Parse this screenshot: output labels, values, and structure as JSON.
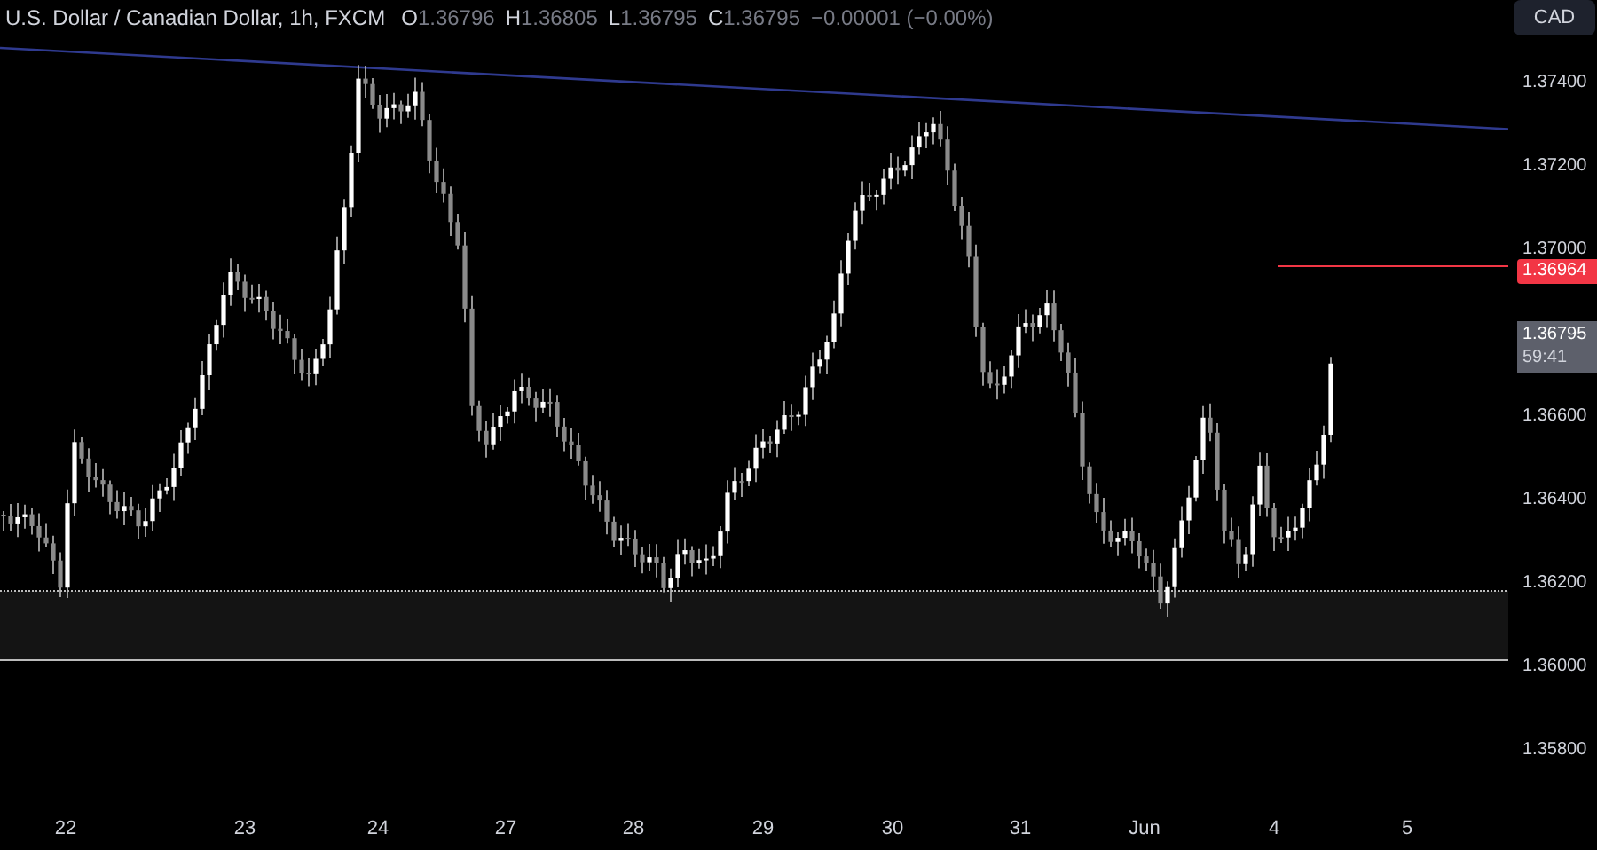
{
  "header": {
    "title": "U.S. Dollar / Canadian Dollar, 1h, FXCM",
    "ohlc": [
      {
        "label": "O",
        "value": "1.36796"
      },
      {
        "label": "H",
        "value": "1.36805"
      },
      {
        "label": "L",
        "value": "1.36795"
      },
      {
        "label": "C",
        "value": "1.36795"
      }
    ],
    "change": "−0.00001 (−0.00%)"
  },
  "currency_button": "CAD",
  "price_axis": [
    "1.37400",
    "1.37200",
    "1.37000",
    "1.36600",
    "1.36400",
    "1.36200",
    "1.36000",
    "1.35800"
  ],
  "alert_price": {
    "value": "1.36964",
    "color": "#f23645"
  },
  "last_price": {
    "value": "1.36795",
    "countdown": "59:41"
  },
  "time_axis": [
    "22",
    "23",
    "24",
    "27",
    "28",
    "29",
    "30",
    "31",
    "Jun",
    "4",
    "5"
  ]
}
